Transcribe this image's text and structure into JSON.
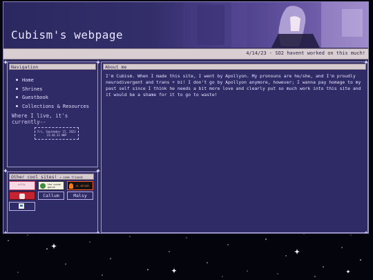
{
  "header": {
    "title": "Cubism's webpage"
  },
  "ticker": {
    "text": "4/14/23 - SO2 havent worked on this much!"
  },
  "nav": {
    "title": "Navigation",
    "items": [
      {
        "label": "Home"
      },
      {
        "label": "Shrines"
      },
      {
        "label": "Guestbook"
      },
      {
        "label": "Collections & Resources"
      }
    ],
    "live_text": "Where I live, it's currently--",
    "clock_lines": [
      "Fri, September 15, 2023",
      "23:44:33 WKP"
    ]
  },
  "about": {
    "title": "About me",
    "text": "I'm Cubism. When I made this site, I went by Apollyon. My pronouns are he/she, and I'm proudly neurodivergent and trans + bi! I don't go by Apollyon anymore, however; I wanna pay homage to my past self since I think he needs a bit more love and clearly put so much work into this site and it would be a shame for it to go to waste!"
  },
  "other_sites": {
    "title": "Other cool sites!",
    "subtitle": "+ some friends",
    "button_texts": [
      "silly",
      "the scene gourd",
      "AL ARCADE"
    ],
    "names": [
      "Callum",
      "Malsy"
    ]
  },
  "colors": {
    "panel_bg": "#2f2b66",
    "border": "#a39cd0",
    "title_bar": "#d6ccd0",
    "text": "#e4e0ff"
  }
}
